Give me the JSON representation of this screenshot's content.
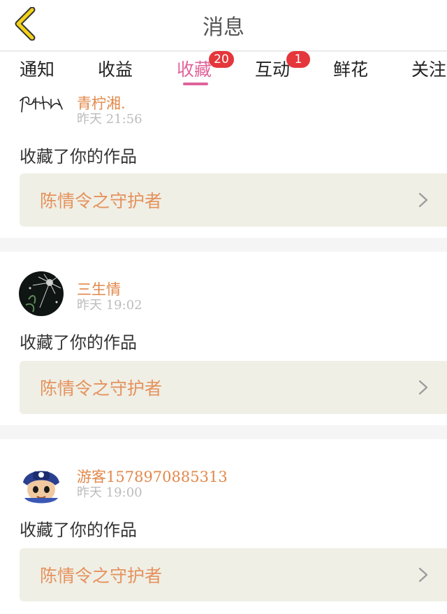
{
  "header": {
    "title": "消息",
    "back_icon": "chevron-left-icon"
  },
  "tabs": [
    {
      "label": "通知"
    },
    {
      "label": "收益"
    },
    {
      "label": "收藏",
      "badge": "20",
      "active": true
    },
    {
      "label": "互动",
      "badge": "1"
    },
    {
      "label": "鲜花"
    },
    {
      "label": "关注"
    }
  ],
  "messages": [
    {
      "username": "青柠湘.",
      "date": "昨天",
      "time": "21:56",
      "action": "收藏了你的作品",
      "work_title": "陈情令之守护者"
    },
    {
      "username": "三生情",
      "date": "昨天",
      "time": "19:02",
      "action": "收藏了你的作品",
      "work_title": "陈情令之守护者"
    },
    {
      "username": "游客1578970885313",
      "date": "昨天",
      "time": "19:00",
      "action": "收藏了你的作品",
      "work_title": "陈情令之守护者"
    }
  ],
  "colors": {
    "accent": "#e0649a",
    "username": "#e2884a",
    "badge": "#e4363b",
    "work_bg": "#efefe6"
  }
}
